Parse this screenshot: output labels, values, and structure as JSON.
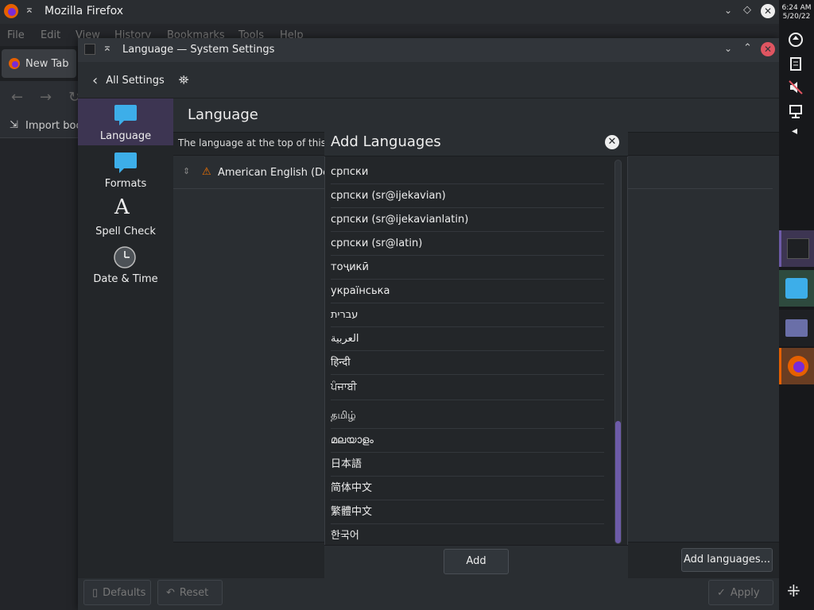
{
  "firefox": {
    "title": "Mozilla Firefox",
    "menu": [
      "File",
      "Edit",
      "View",
      "History",
      "Bookmarks",
      "Tools",
      "Help"
    ],
    "tab_label": "New Tab",
    "import_label": "Import boo"
  },
  "settings": {
    "title": "Language — System Settings",
    "back_label": "All Settings",
    "sidebar": [
      {
        "label": "Language",
        "icon": "speech-bubble-icon"
      },
      {
        "label": "Formats",
        "icon": "speech-bubble-icon"
      },
      {
        "label": "Spell Check",
        "icon": "spell-check-icon"
      },
      {
        "label": "Date & Time",
        "icon": "clock-icon"
      }
    ],
    "page_title": "Language",
    "description": "The language at the top of this",
    "configured_language": "American English (Def",
    "add_languages_button": "Add languages...",
    "footer": {
      "defaults": "Defaults",
      "reset": "Reset",
      "apply": "Apply"
    }
  },
  "dialog": {
    "title": "Add Languages",
    "add_button": "Add",
    "languages": [
      "српски",
      "српски (sr@ijekavian)",
      "српски (sr@ijekavianlatin)",
      "српски (sr@latin)",
      "тоҷикӣ",
      "українська",
      "עברית",
      "العربية",
      "हिन्दी",
      "ਪੰਜਾਬੀ",
      "தமிழ்",
      "മലയാളം",
      "日本語",
      "简体中文",
      "繁體中文",
      "한국어"
    ],
    "scroll_position": 0.92
  },
  "panel": {
    "time": "6:24 AM",
    "date": "5/20/22"
  },
  "colors": {
    "accent": "#6d5ba8",
    "active_sidebar": "#3d3552"
  }
}
